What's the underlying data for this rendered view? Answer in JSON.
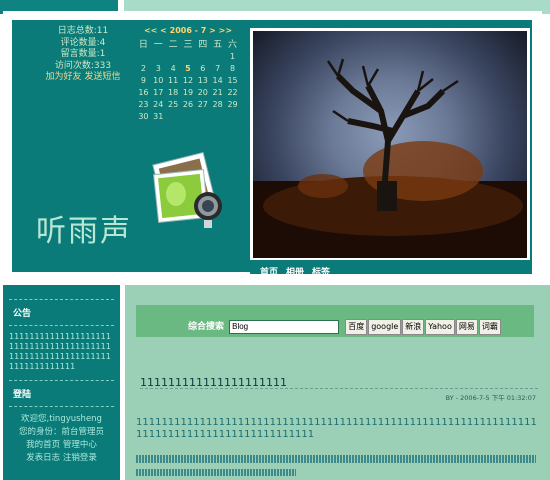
{
  "stats": {
    "log_count": "日志总数:11",
    "comment_count": "评论数量:4",
    "message_count": "留言数量:1",
    "visit_count": "访问次数:333",
    "add_friend": "加为好友",
    "send_message": "发送短信"
  },
  "calendar": {
    "nav": "<< < 2006 - 7 > >>",
    "weekdays": [
      "日",
      "一",
      "二",
      "三",
      "四",
      "五",
      "六"
    ],
    "rows": [
      [
        "",
        "",
        "",
        "",
        "",
        "",
        "1"
      ],
      [
        "2",
        "3",
        "4",
        "5",
        "6",
        "7",
        "8"
      ],
      [
        "9",
        "10",
        "11",
        "12",
        "13",
        "14",
        "15"
      ],
      [
        "16",
        "17",
        "18",
        "19",
        "20",
        "21",
        "22"
      ],
      [
        "23",
        "24",
        "25",
        "26",
        "27",
        "28",
        "29"
      ],
      [
        "30",
        "31",
        "",
        "",
        "",
        "",
        ""
      ]
    ],
    "today": "5"
  },
  "site": {
    "title": "听雨声"
  },
  "photo_nav": {
    "items": [
      "首页",
      "相册",
      "标签"
    ]
  },
  "sidebar": {
    "notice_title": "公告",
    "notice_text": "1111111111111111111111111111111111111111111111111111111111111111111111111",
    "login_title": "登陆",
    "welcome": "欢迎您,tingyusheng",
    "role": "您的身份：前台管理员",
    "links": [
      "我的首页",
      "管理中心"
    ],
    "links2": [
      "发表日志",
      "注销登录"
    ]
  },
  "search": {
    "label": "综合搜索",
    "value": "Blog",
    "buttons": [
      "百度",
      "google",
      "新浪",
      "Yahoo",
      "网易",
      "词霸"
    ]
  },
  "post": {
    "title": "111111111111111111111",
    "meta": "BY - 2006-7-5 下午 01:32:07",
    "body": "1111111111111111111111111111111111111111111111111111111111111111111111111111111111111111111"
  },
  "colors": {
    "teal": "#0a7b78",
    "mint": "#9bd0b7",
    "green": "#6ab882"
  }
}
